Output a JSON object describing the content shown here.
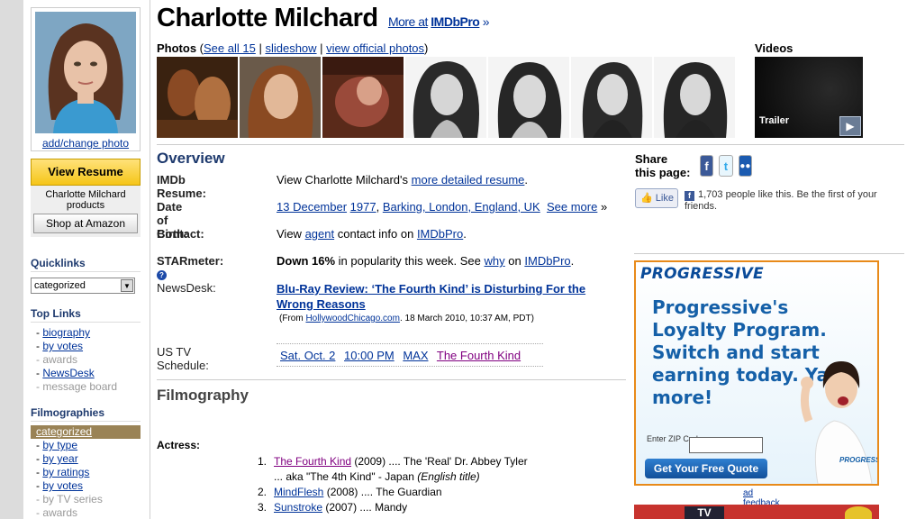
{
  "sidebar": {
    "add_change_photo": "add/change photo",
    "view_resume": "View Resume",
    "products_text": "Charlotte Milchard products",
    "shop_amazon": "Shop at Amazon",
    "quicklinks_heading": "Quicklinks",
    "quicklinks_selected": "categorized",
    "toplinks_heading": "Top Links",
    "toplinks": [
      {
        "label": "biography",
        "active": true
      },
      {
        "label": "by votes",
        "active": true
      },
      {
        "label": "awards",
        "active": false
      },
      {
        "label": "NewsDesk",
        "active": true
      },
      {
        "label": "message board",
        "active": false
      }
    ],
    "filmographies_heading": "Filmographies",
    "filmographies": [
      {
        "label": "categorized",
        "selected": true
      },
      {
        "label": "by type",
        "active": true
      },
      {
        "label": "by year",
        "active": true
      },
      {
        "label": "by ratings",
        "active": true
      },
      {
        "label": "by votes",
        "active": true
      },
      {
        "label": "by TV series",
        "active": false
      },
      {
        "label": "awards",
        "active": false
      }
    ]
  },
  "header": {
    "name": "Charlotte Milchard",
    "more_at": "More at",
    "imdbpro": "IMDbPro",
    "raquo": "»"
  },
  "photos": {
    "label": "Photos",
    "see_all": "See all 15",
    "slideshow": "slideshow",
    "official": "view official photos"
  },
  "videos": {
    "label": "Videos",
    "trailer": "Trailer"
  },
  "overview": {
    "heading": "Overview",
    "resume_label": "IMDb Resume:",
    "resume_text": "View Charlotte Milchard's",
    "resume_link": "more detailed resume",
    "dob_label": "Date of Birth:",
    "dob_day": "13 December",
    "dob_year": "1977",
    "dob_place": "Barking, London, England, UK",
    "dob_more": "See more",
    "contact_label": "Contact:",
    "contact_view": "View",
    "contact_agent": "agent",
    "contact_mid": "contact info on",
    "contact_pro": "IMDbPro",
    "starmeter_label": "STARmeter:",
    "starmeter_down": "Down 16%",
    "starmeter_text": "in popularity this week. See",
    "starmeter_why": "why",
    "starmeter_on": "on",
    "starmeter_pro": "IMDbPro",
    "newsdesk_label": "NewsDesk:",
    "newsdesk_headline": "Blu-Ray Review: ‘The Fourth Kind’ is Disturbing For the Wrong Reasons",
    "newsdesk_from": "(From",
    "newsdesk_source": "HollywoodChicago.com",
    "newsdesk_date": ". 18 March 2010, 10:37 AM, PDT)",
    "tv_label": "US TV Schedule:",
    "tv_date": "Sat. Oct. 2",
    "tv_time": "10:00 PM",
    "tv_channel": "MAX",
    "tv_title": "The Fourth Kind"
  },
  "filmography": {
    "heading": "Filmography",
    "actress_label": "Actress:",
    "items": [
      {
        "num": "1.",
        "title": "The Fourth Kind",
        "year": "(2009)",
        "role": ".... The 'Real' Dr. Abbey Tyler"
      },
      {
        "num": "",
        "title": "",
        "year": "",
        "role": "... aka \"The 4th Kind\" - Japan"
      },
      {
        "num": "2.",
        "title": "MindFlesh",
        "year": "(2008)",
        "role": ".... The Guardian"
      },
      {
        "num": "3.",
        "title": "Sunstroke",
        "year": "(2007)",
        "role": ".... Mandy"
      }
    ],
    "aka_note": "(English title)"
  },
  "share": {
    "label": "Share this page:",
    "like": "Like",
    "like_text": "1,703 people like this. Be the first of your friends."
  },
  "ad": {
    "brand": "PROGRESSIVE",
    "headline": "Progressive's Loyalty Program. Switch and start earning today. Yay, more!",
    "zip_label": "Enter ZIP Code:",
    "quote_button": "Get Your Free Quote",
    "feedback": "ad feedback",
    "ad2_text": "TV"
  },
  "colors": {
    "link": "#003399",
    "visited": "#800080",
    "heading": "#1e3a6e",
    "resume_yellow": "#f5c518",
    "ad_border": "#e88a1a"
  }
}
